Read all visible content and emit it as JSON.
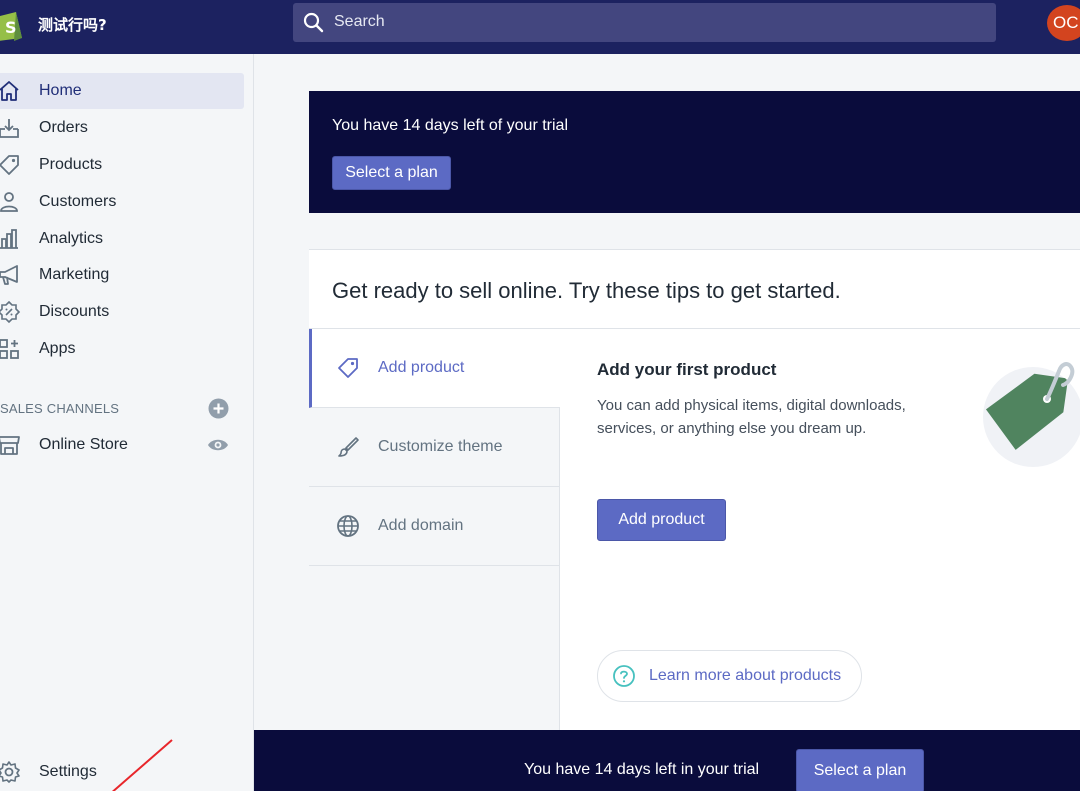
{
  "topbar": {
    "store_name": "测试行吗?",
    "search_placeholder": "Search",
    "avatar_initials": "OC",
    "bar_color": "#1c2260"
  },
  "sidebar": {
    "items": [
      {
        "label": "Home",
        "icon": "home-icon",
        "active": true
      },
      {
        "label": "Orders",
        "icon": "orders-icon"
      },
      {
        "label": "Products",
        "icon": "tag-icon"
      },
      {
        "label": "Customers",
        "icon": "person-icon"
      },
      {
        "label": "Analytics",
        "icon": "bar-chart-icon"
      },
      {
        "label": "Marketing",
        "icon": "megaphone-icon"
      },
      {
        "label": "Discounts",
        "icon": "discount-icon"
      },
      {
        "label": "Apps",
        "icon": "apps-icon"
      }
    ],
    "sales_channels_title": "SALES CHANNELS",
    "channels": [
      {
        "label": "Online Store",
        "icon": "store-icon"
      }
    ],
    "settings_label": "Settings"
  },
  "trial_banner": {
    "text": "You have 14 days left of your trial",
    "button_label": "Select a plan"
  },
  "tips": {
    "title": "Get ready to sell online. Try these tips to get started.",
    "tabs": [
      {
        "label": "Add product",
        "icon": "tag-icon",
        "active": true
      },
      {
        "label": "Customize theme",
        "icon": "brush-icon"
      },
      {
        "label": "Add domain",
        "icon": "globe-icon"
      }
    ],
    "content": {
      "heading": "Add your first product",
      "description": "You can add physical items, digital downloads, services, or anything else you dream up.",
      "button_label": "Add product",
      "learn_more": "Learn more about products"
    }
  },
  "bottom_bar": {
    "text": "You have 14 days left in your trial",
    "button_label": "Select a plan"
  },
  "colors": {
    "accent": "#5c6ac4",
    "banner": "#0a0c3c",
    "avatar": "#d3441f",
    "illustration": "#50845f"
  }
}
